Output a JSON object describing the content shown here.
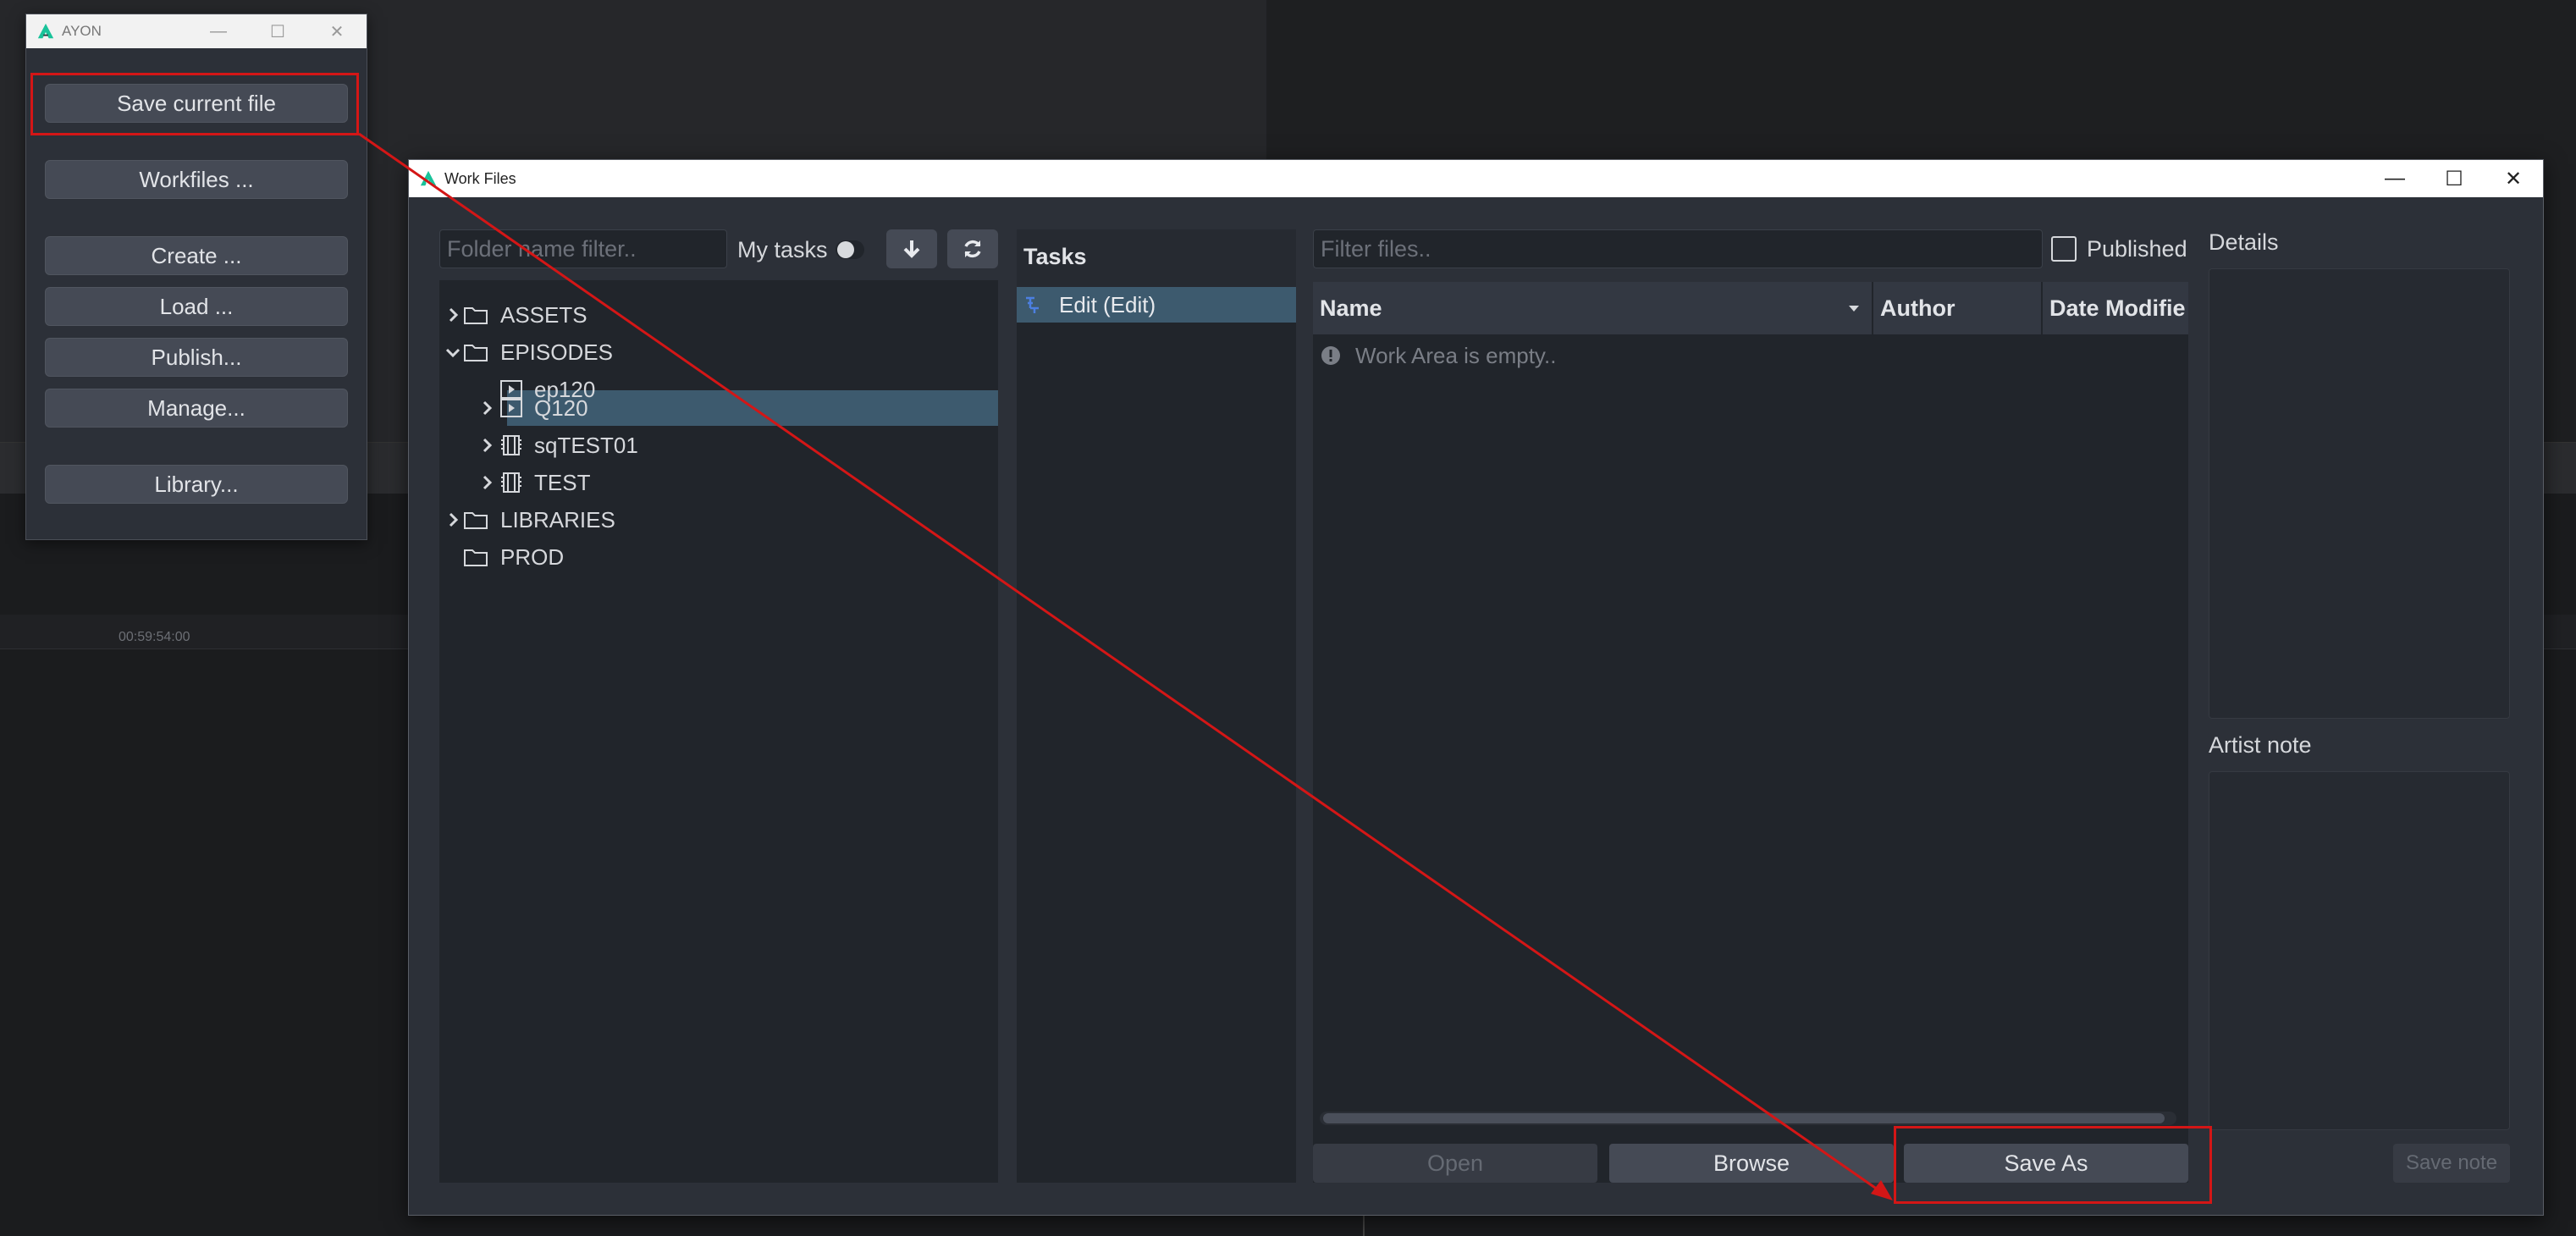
{
  "background": {
    "timecode": "00:59:54:00"
  },
  "ayon": {
    "title": "AYON",
    "buttons": [
      {
        "label": "Save current file"
      },
      {
        "label": "Workfiles ..."
      },
      {
        "label": "Create ..."
      },
      {
        "label": "Load ..."
      },
      {
        "label": "Publish..."
      },
      {
        "label": "Manage..."
      },
      {
        "label": "Library..."
      }
    ]
  },
  "workfiles": {
    "title": "Work Files",
    "folder_filter": {
      "placeholder": "Folder name filter..",
      "value": ""
    },
    "my_tasks_label": "My tasks",
    "tree": [
      {
        "label": "ASSETS"
      },
      {
        "label": "EPISODES"
      },
      {
        "label": "ep120"
      },
      {
        "label": "Q120"
      },
      {
        "label": "sqTEST01"
      },
      {
        "label": "TEST"
      },
      {
        "label": "LIBRARIES"
      },
      {
        "label": "PROD"
      }
    ],
    "tasks_header": "Tasks",
    "tasks": [
      {
        "label": "Edit (Edit)"
      }
    ],
    "file_filter": {
      "placeholder": "Filter files..",
      "value": ""
    },
    "published_label": "Published",
    "columns": {
      "name": "Name",
      "author": "Author",
      "date": "Date Modifie"
    },
    "empty_message": "Work Area is empty..",
    "buttons": {
      "open": "Open",
      "browse": "Browse",
      "save_as": "Save As",
      "save_note": "Save note"
    },
    "details_label": "Details",
    "artist_note_label": "Artist note"
  },
  "colors": {
    "accent_selection": "#3d5a6e",
    "annotation_red": "#d41616",
    "logo_green": "#19c39a"
  }
}
